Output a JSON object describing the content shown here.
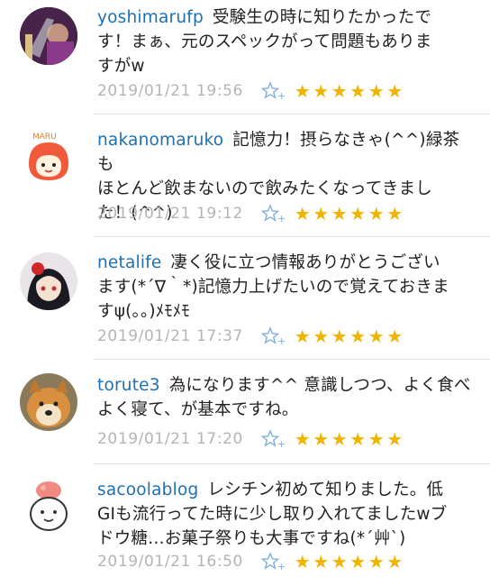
{
  "comments": [
    {
      "user": "yoshimarufp",
      "text_lines": [
        "受験生の時に知りたかったで",
        "す！まぁ、元のスペックがって問題もありま",
        "すがw"
      ],
      "date": "2019/01/21 19:56",
      "star_count": 6
    },
    {
      "user": "nakanomaruko",
      "text_lines": [
        "記憶力！摂らなきゃ(^^)緑茶も",
        "ほとんど飲まないので飲みたくなってきまし",
        "た！(^^)"
      ],
      "date": "2019/01/21 19:12",
      "star_count": 6
    },
    {
      "user": "netalife",
      "text_lines": [
        "凄く役に立つ情報ありがとうござい",
        "ます(*´∇｀*)記憶力上げたいので覚えておきま",
        "すψ(。。)ﾒﾓﾒﾓ"
      ],
      "date": "2019/01/21 17:37",
      "star_count": 6
    },
    {
      "user": "torute3",
      "text_lines": [
        "為になります^^ 意識しつつ、よく食べ",
        "よく寝て、が基本ですね。"
      ],
      "date": "2019/01/21 17:20",
      "star_count": 6
    },
    {
      "user": "sacoolablog",
      "text_lines": [
        "レシチン初めて知りました。低",
        "GIも流行ってた時に少し取り入れてましたwブ",
        "ドウ糖…お菓子祭りも大事ですね(*´艸`)"
      ],
      "date": "2019/01/21 16:50",
      "star_count": 6
    }
  ],
  "star_glyph": "★",
  "colors": {
    "username": "#1e6fb0",
    "date": "#b4b4b4",
    "star": "#f0b400",
    "add_star": "#7fb1e0"
  },
  "icons": [
    "add-star-icon"
  ]
}
